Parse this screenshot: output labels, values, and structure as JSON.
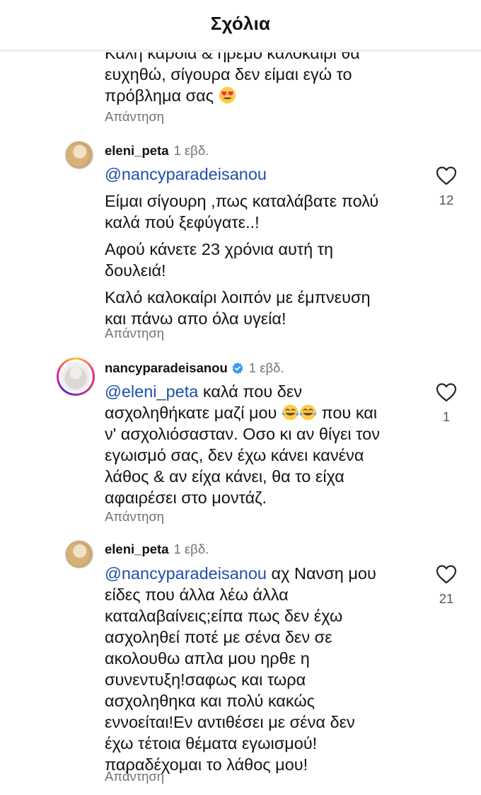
{
  "header": {
    "title": "Σχόλια"
  },
  "previous_comment": {
    "lines": [
      "Καλή καρδιά & ήρεμο καλοκαίρι θα",
      "ευχηθώ, σίγουρα δεν είμαι εγώ το",
      "πρόβλημα σας"
    ],
    "reply_label": "Απάντηση"
  },
  "comments": [
    {
      "username": "eleni_peta",
      "time": "1 εβδ.",
      "mention": "@nancyparadeisanou",
      "lines_para1": [
        "Είμαι σίγουρη ,πως καταλάβατε πολύ",
        "καλά πού ξεφύγατε..!"
      ],
      "lines_para2": [
        "Αφού κάνετε 23 χρόνια αυτή  τη",
        "δουλειά!"
      ],
      "lines_para3": [
        "Καλό καλοκαίρι λοιπόν με έμπνευση",
        "και πάνω απο όλα υγεία!"
      ],
      "likes": "12",
      "reply_label": "Απάντηση"
    },
    {
      "username": "nancyparadeisanou",
      "time": "1 εβδ.",
      "mention": "@eleni_peta",
      "first_line_rest": " καλά που δεν",
      "line2_before": "ασχοληθήκατε μαζί μου ",
      "line2_after": " που και",
      "lines_rest": [
        "ν' ασχολιόσασταν. Οσο κι αν θίγει τον",
        "εγωισμό σας, δεν έχω κάνει κανένα",
        "λάθος & αν είχα κάνει, θα το είχα",
        "αφαιρέσει στο μοντάζ."
      ],
      "likes": "1",
      "reply_label": "Απάντηση"
    },
    {
      "username": "eleni_peta",
      "time": "1 εβδ.",
      "mention": "@nancyparadeisanou",
      "first_line_rest": " αχ Νανση μου",
      "lines_rest": [
        "είδες που άλλα λέω άλλα",
        "καταλαβαίνεις;είπα πως δεν έχω",
        "ασχοληθεί ποτέ με σένα δεν σε",
        "ακολουθω απλα μου ηρθε η",
        "συνεντυξη!σαφως και τωρα",
        "ασχοληθηκα και πολύ κακώς",
        "εννοείται!Εν αντιθέσει  με σένα δεν",
        "έχω τέτοια θέματα εγωισμού!",
        "παραδέχομαι το λάθος μου!"
      ],
      "likes": "21",
      "reply_label": "Απάντηση"
    }
  ],
  "icons": {
    "heart": "heart-outline-icon",
    "verified": "verified-badge-icon",
    "heart_eyes": "heart-eyes-emoji",
    "tears_of_joy": "tears-of-joy-emoji"
  },
  "colors": {
    "mention": "#1f4fa8",
    "secondary_text": "#737373",
    "verified": "#3897f0"
  }
}
